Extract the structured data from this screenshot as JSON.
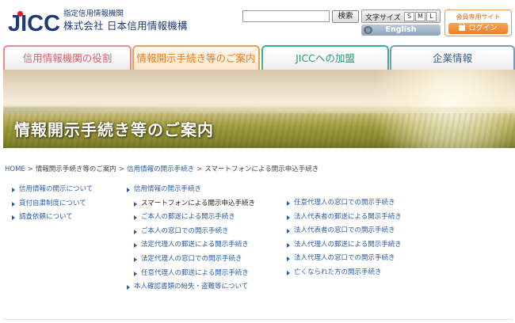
{
  "header": {
    "logo_text": "JICC",
    "logo_subtitle": "指定信用情報機関",
    "logo_name": "株式会社 日本信用情報機構",
    "search": {
      "placeholder": "",
      "button_label": "検索"
    },
    "font_size": {
      "label": "文字サイズ",
      "options": [
        "S",
        "M",
        "L"
      ]
    },
    "english_label": "English",
    "member": {
      "title": "会員専用サイト",
      "login_label": "ログイン"
    }
  },
  "nav": {
    "tabs": [
      {
        "label": "信用情報機関の役割"
      },
      {
        "label": "情報開示手続き等のご案内",
        "active": true
      },
      {
        "label": "JICCへの加盟"
      },
      {
        "label": "企業情報"
      }
    ]
  },
  "hero": {
    "title": "情報開示手続き等のご案内"
  },
  "breadcrumb": {
    "items": [
      "HOME",
      "情報開示手続き等のご案内",
      "信用情報の開示手続き",
      "スマートフォンによる開示申込手続き"
    ],
    "separator": ">"
  },
  "links": {
    "left": [
      "信用情報の開示について",
      "貸付自粛制度について",
      "調査依頼について"
    ],
    "middle_heading": "信用情報の開示手続き",
    "middle": [
      "スマートフォンによる開示申込手続き",
      "ご本人の郵送による開示手続き",
      "ご本人の窓口での開示手続き",
      "法定代理人の郵送による開示手続き",
      "法定代理人の窓口での開示手続き",
      "任意代理人の郵送による開示手続き"
    ],
    "middle_footer": "本人確認書類の紛失・盗難等について",
    "right": [
      "任意代理人の窓口での開示手続き",
      "法人代表者の郵送による開示手続き",
      "法人代表者の窓口での開示手続き",
      "法人代理人の郵送による開示手続き",
      "法人代理人の窓口での開示手続き",
      "亡くなられた方の開示手続き"
    ]
  },
  "colors": {
    "brand_navy": "#1e3a78",
    "link_blue": "#2d5da8",
    "tab_pink": "#ea8b91",
    "tab_orange": "#f0a04e",
    "tab_green": "#3cae8f",
    "tab_slate": "#7a9ab8",
    "login_orange": "#ea7f24"
  }
}
